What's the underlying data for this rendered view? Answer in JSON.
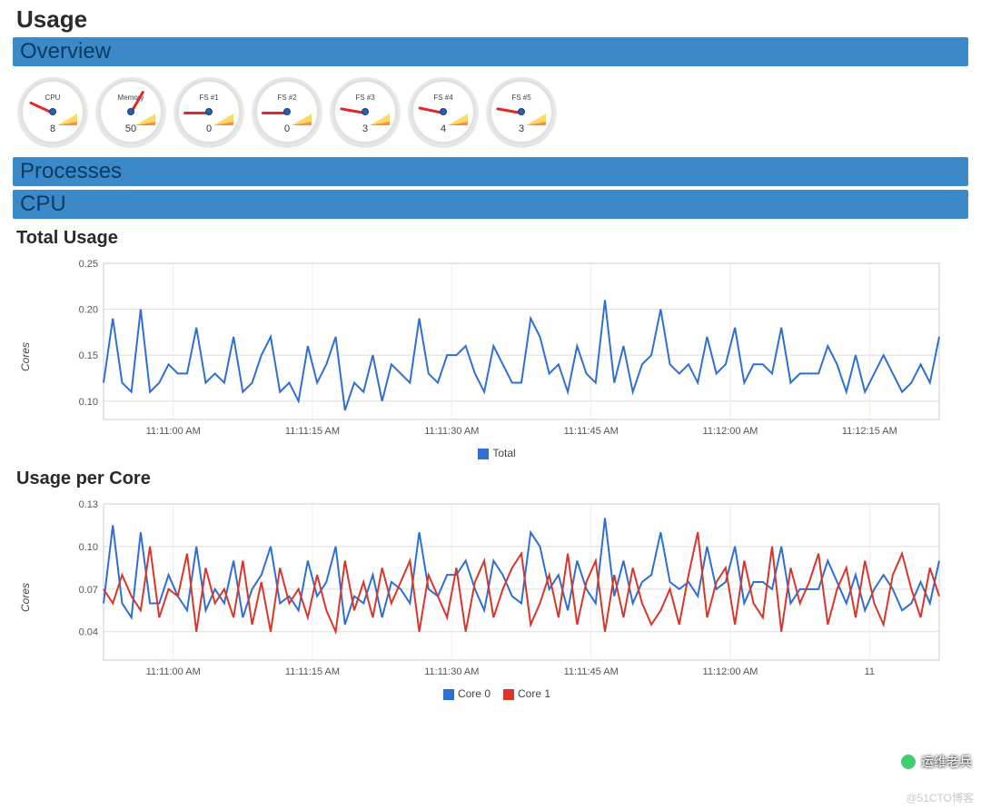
{
  "titles": {
    "page": "Usage",
    "overview": "Overview",
    "processes": "Processes",
    "cpu": "CPU",
    "total_usage": "Total Usage",
    "usage_per_core": "Usage per Core"
  },
  "gauges": [
    {
      "label": "CPU",
      "value": "8",
      "angle": 205
    },
    {
      "label": "Memory",
      "value": "50",
      "angle": 300
    },
    {
      "label": "FS #1",
      "value": "0",
      "angle": 180
    },
    {
      "label": "FS #2",
      "value": "0",
      "angle": 180
    },
    {
      "label": "FS #3",
      "value": "3",
      "angle": 190
    },
    {
      "label": "FS #4",
      "value": "4",
      "angle": 192
    },
    {
      "label": "FS #5",
      "value": "3",
      "angle": 190
    }
  ],
  "watermark": {
    "text": "运维老兵",
    "footer": "@51CTO博客"
  },
  "colors": {
    "blue": "#2e6fd1",
    "red": "#d9362b",
    "barA": "#3b89c9",
    "barText": "#0b3b63"
  },
  "chart_data": [
    {
      "id": "total",
      "type": "line",
      "title": "Total Usage",
      "xlabel": "",
      "ylabel": "Cores",
      "ylim": [
        0.08,
        0.25
      ],
      "yticks": [
        0.1,
        0.15,
        0.2,
        0.25
      ],
      "x_tick_labels": [
        "11:11:00 AM",
        "11:11:15 AM",
        "11:11:30 AM",
        "11:11:45 AM",
        "11:12:00 AM",
        "11:12:15 AM"
      ],
      "x": [
        0,
        1,
        2,
        3,
        4,
        5,
        6,
        7,
        8,
        9,
        10,
        11,
        12,
        13,
        14,
        15,
        16,
        17,
        18,
        19,
        20,
        21,
        22,
        23,
        24,
        25,
        26,
        27,
        28,
        29,
        30,
        31,
        32,
        33,
        34,
        35,
        36,
        37,
        38,
        39,
        40,
        41,
        42,
        43,
        44,
        45,
        46,
        47,
        48,
        49,
        50,
        51,
        52,
        53,
        54,
        55,
        56,
        57,
        58,
        59,
        60,
        61,
        62,
        63,
        64,
        65,
        66,
        67,
        68,
        69,
        70,
        71,
        72,
        73,
        74,
        75,
        76,
        77,
        78,
        79,
        80,
        81,
        82,
        83,
        84,
        85,
        86,
        87,
        88,
        89,
        90
      ],
      "series": [
        {
          "name": "Total",
          "color": "#2e6fd1",
          "values": [
            0.12,
            0.19,
            0.12,
            0.11,
            0.2,
            0.11,
            0.12,
            0.14,
            0.13,
            0.13,
            0.18,
            0.12,
            0.13,
            0.12,
            0.17,
            0.11,
            0.12,
            0.15,
            0.17,
            0.11,
            0.12,
            0.1,
            0.16,
            0.12,
            0.14,
            0.17,
            0.09,
            0.12,
            0.11,
            0.15,
            0.1,
            0.14,
            0.13,
            0.12,
            0.19,
            0.13,
            0.12,
            0.15,
            0.15,
            0.16,
            0.13,
            0.11,
            0.16,
            0.14,
            0.12,
            0.12,
            0.19,
            0.17,
            0.13,
            0.14,
            0.11,
            0.16,
            0.13,
            0.12,
            0.21,
            0.12,
            0.16,
            0.11,
            0.14,
            0.15,
            0.2,
            0.14,
            0.13,
            0.14,
            0.12,
            0.17,
            0.13,
            0.14,
            0.18,
            0.12,
            0.14,
            0.14,
            0.13,
            0.18,
            0.12,
            0.13,
            0.13,
            0.13,
            0.16,
            0.14,
            0.11,
            0.15,
            0.11,
            0.13,
            0.15,
            0.13,
            0.11,
            0.12,
            0.14,
            0.12,
            0.17
          ]
        }
      ],
      "legend": [
        "Total"
      ]
    },
    {
      "id": "percore",
      "type": "line",
      "title": "Usage per Core",
      "xlabel": "",
      "ylabel": "Cores",
      "ylim": [
        0.02,
        0.13
      ],
      "yticks": [
        0.04,
        0.07,
        0.1,
        0.13
      ],
      "x_tick_labels": [
        "11:11:00 AM",
        "11:11:15 AM",
        "11:11:30 AM",
        "11:11:45 AM",
        "11:12:00 AM",
        "11"
      ],
      "x": [
        0,
        1,
        2,
        3,
        4,
        5,
        6,
        7,
        8,
        9,
        10,
        11,
        12,
        13,
        14,
        15,
        16,
        17,
        18,
        19,
        20,
        21,
        22,
        23,
        24,
        25,
        26,
        27,
        28,
        29,
        30,
        31,
        32,
        33,
        34,
        35,
        36,
        37,
        38,
        39,
        40,
        41,
        42,
        43,
        44,
        45,
        46,
        47,
        48,
        49,
        50,
        51,
        52,
        53,
        54,
        55,
        56,
        57,
        58,
        59,
        60,
        61,
        62,
        63,
        64,
        65,
        66,
        67,
        68,
        69,
        70,
        71,
        72,
        73,
        74,
        75,
        76,
        77,
        78,
        79,
        80,
        81,
        82,
        83,
        84,
        85,
        86,
        87,
        88,
        89,
        90
      ],
      "series": [
        {
          "name": "Core 0",
          "color": "#2e6fd1",
          "values": [
            0.06,
            0.115,
            0.06,
            0.05,
            0.11,
            0.06,
            0.06,
            0.08,
            0.065,
            0.055,
            0.1,
            0.055,
            0.07,
            0.06,
            0.09,
            0.05,
            0.07,
            0.08,
            0.1,
            0.06,
            0.065,
            0.055,
            0.09,
            0.065,
            0.075,
            0.1,
            0.045,
            0.065,
            0.06,
            0.08,
            0.05,
            0.075,
            0.07,
            0.06,
            0.11,
            0.07,
            0.065,
            0.08,
            0.08,
            0.09,
            0.07,
            0.055,
            0.09,
            0.08,
            0.065,
            0.06,
            0.11,
            0.1,
            0.07,
            0.08,
            0.055,
            0.09,
            0.07,
            0.06,
            0.12,
            0.065,
            0.09,
            0.06,
            0.075,
            0.08,
            0.11,
            0.075,
            0.07,
            0.075,
            0.065,
            0.1,
            0.07,
            0.075,
            0.1,
            0.06,
            0.075,
            0.075,
            0.07,
            0.1,
            0.06,
            0.07,
            0.07,
            0.07,
            0.09,
            0.075,
            0.06,
            0.08,
            0.055,
            0.07,
            0.08,
            0.07,
            0.055,
            0.06,
            0.075,
            0.06,
            0.09
          ]
        },
        {
          "name": "Core 1",
          "color": "#d9362b",
          "values": [
            0.07,
            0.06,
            0.08,
            0.065,
            0.055,
            0.1,
            0.05,
            0.07,
            0.065,
            0.095,
            0.04,
            0.085,
            0.06,
            0.07,
            0.05,
            0.09,
            0.045,
            0.075,
            0.04,
            0.085,
            0.06,
            0.07,
            0.05,
            0.08,
            0.055,
            0.04,
            0.09,
            0.055,
            0.075,
            0.05,
            0.085,
            0.06,
            0.075,
            0.09,
            0.04,
            0.08,
            0.065,
            0.05,
            0.085,
            0.04,
            0.075,
            0.09,
            0.05,
            0.07,
            0.085,
            0.095,
            0.045,
            0.06,
            0.08,
            0.05,
            0.095,
            0.045,
            0.075,
            0.09,
            0.04,
            0.08,
            0.05,
            0.085,
            0.06,
            0.045,
            0.055,
            0.07,
            0.045,
            0.08,
            0.11,
            0.05,
            0.075,
            0.085,
            0.045,
            0.09,
            0.06,
            0.05,
            0.1,
            0.04,
            0.085,
            0.06,
            0.075,
            0.095,
            0.045,
            0.07,
            0.085,
            0.05,
            0.09,
            0.06,
            0.045,
            0.08,
            0.095,
            0.07,
            0.05,
            0.085,
            0.065
          ]
        }
      ],
      "legend": [
        "Core 0",
        "Core 1"
      ]
    }
  ]
}
